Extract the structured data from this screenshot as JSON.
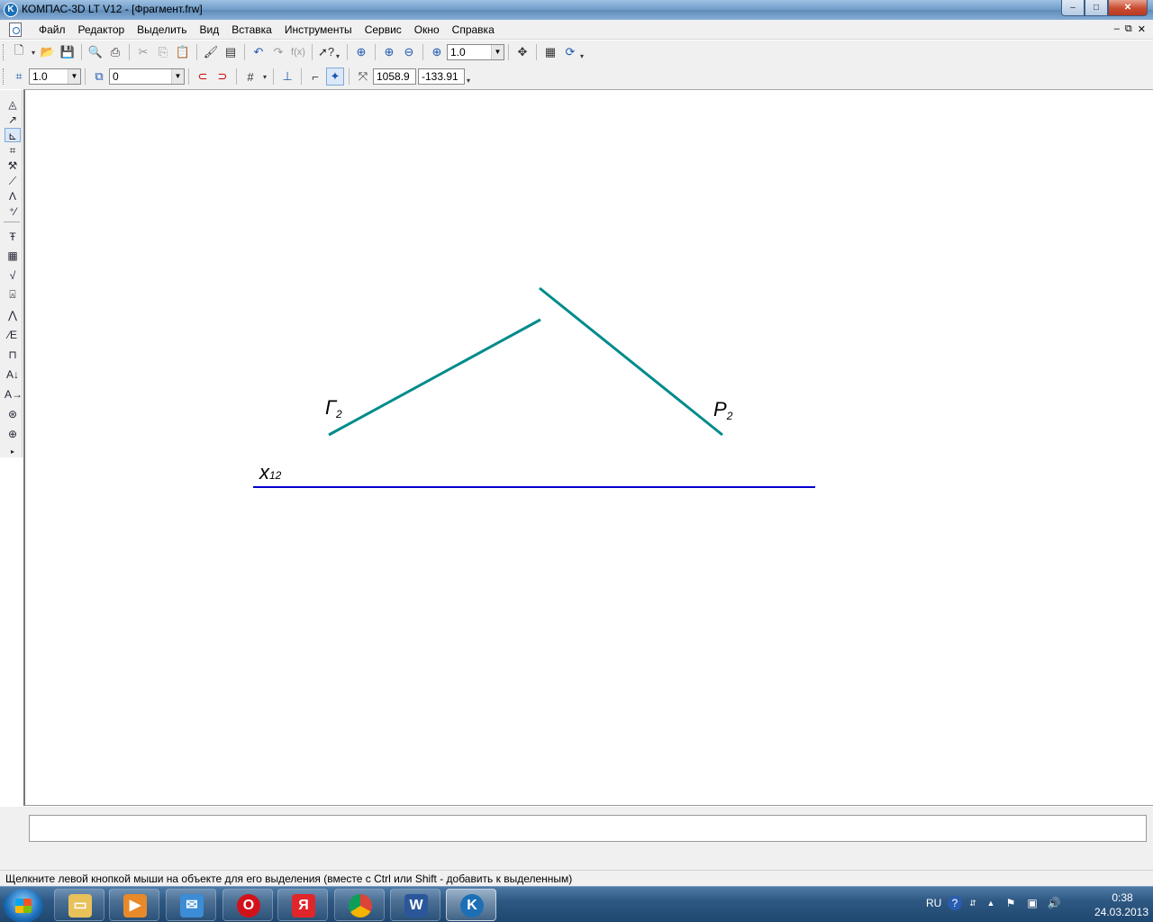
{
  "window": {
    "title": "КОМПАС-3D LT V12 - [Фрагмент.frw]",
    "controls": {
      "minimize": "–",
      "maximize": "□",
      "close": "✕"
    }
  },
  "menu": {
    "items": [
      "Файл",
      "Редактор",
      "Выделить",
      "Вид",
      "Вставка",
      "Инструменты",
      "Сервис",
      "Окно",
      "Справка"
    ],
    "mdi_controls": [
      "–",
      "⧉",
      "✕"
    ]
  },
  "toolbar_standard": {
    "zoom_value": "1.0",
    "icons": [
      "new-icon",
      "open-icon",
      "save-icon",
      "print-preview-icon",
      "print-icon",
      "cut-icon",
      "copy-icon",
      "paste-icon",
      "format-painter-icon",
      "properties-icon",
      "undo-icon",
      "redo-icon",
      "function-icon",
      "help-cursor-icon",
      "zoom-window-icon",
      "zoom-in-icon",
      "zoom-out-icon",
      "zoom-scale-icon",
      "pan-icon",
      "refresh-icon"
    ]
  },
  "toolbar_current_state": {
    "step_value": "1.0",
    "layer_value": "0",
    "coord_x": "1058.9",
    "coord_y": "-133.91"
  },
  "left_panel": {
    "icons": [
      "geometry-icon",
      "dimensions-icon",
      "designations-icon",
      "edit-icon",
      "parametrization-icon",
      "measure-icon",
      "select-icon",
      "constraints-icon",
      "text-icon",
      "table-icon",
      "roughness-icon",
      "base-icon",
      "leader-icon",
      "position-icon",
      "tolerance-icon",
      "cut-line-icon",
      "view-arrow-icon",
      "axis-icon",
      "center-mark-icon"
    ]
  },
  "drawing": {
    "labels": {
      "gamma": "Г",
      "gamma_sub": "2",
      "p": "P",
      "p_sub": "2",
      "x": "x",
      "x_sub": "12"
    },
    "colors": {
      "trace_lines": "#008b8b",
      "axis_line": "#0000d0",
      "label": "#000000"
    }
  },
  "status": {
    "hint": "Щелкните левой кнопкой мыши на объекте для его выделения (вместе с Ctrl или Shift - добавить к выделенным)"
  },
  "taskbar": {
    "apps": [
      "explorer",
      "media-player",
      "mail",
      "opera",
      "yandex",
      "chrome",
      "word",
      "kompas"
    ],
    "tray": {
      "lang": "RU",
      "time": "0:38",
      "date": "24.03.2013"
    }
  }
}
